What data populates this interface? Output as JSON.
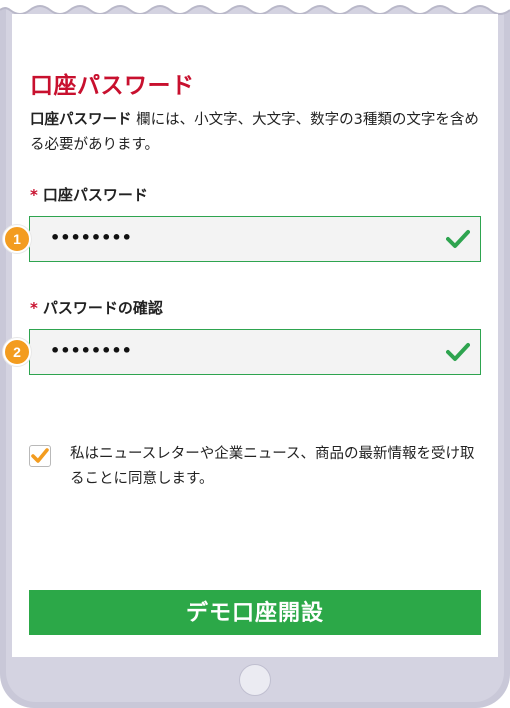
{
  "header": {
    "title": "口座パスワード"
  },
  "description": {
    "field_name": "口座パスワード",
    "text": " 欄には、小文字、大文字、数字の3種類の文字を含める必要があります。"
  },
  "password_field": {
    "required_mark": "*",
    "label": "口座パスワード",
    "value": "••••••••",
    "step": "1",
    "valid": true
  },
  "confirm_field": {
    "required_mark": "*",
    "label": "パスワードの確認",
    "value": "••••••••",
    "step": "2",
    "valid": true
  },
  "consent": {
    "checked": true,
    "text": "私はニュースレターや企業ニュース、商品の最新情報を受け取ることに同意します。"
  },
  "cta": {
    "label": "デモ口座開設"
  },
  "colors": {
    "accent_red": "#c8102e",
    "valid_green": "#2ea44f",
    "button_green": "#2ca848",
    "badge_orange": "#f39c1f"
  },
  "icons": {
    "valid": "check-icon",
    "consent": "checkbox-checked-icon"
  }
}
